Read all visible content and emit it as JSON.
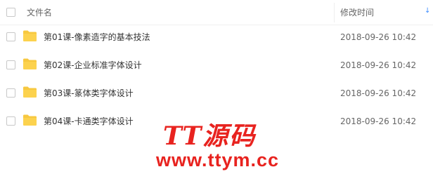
{
  "header": {
    "name_label": "文件名",
    "time_label": "修改时间",
    "sort_icon": "sort-arrow-down-icon"
  },
  "files": [
    {
      "name": "第01课-像素造字的基本技法",
      "modified": "2018-09-26 10:42",
      "icon": "folder-icon"
    },
    {
      "name": "第02课-企业标准字体设计",
      "modified": "2018-09-26 10:42",
      "icon": "folder-icon"
    },
    {
      "name": "第03课-篆体类字体设计",
      "modified": "2018-09-26 10:42",
      "icon": "folder-icon"
    },
    {
      "name": "第04课-卡通类字体设计",
      "modified": "2018-09-26 10:42",
      "icon": "folder-icon"
    }
  ],
  "watermark": {
    "title": "TT源码",
    "url": "www.ttym.cc"
  },
  "colors": {
    "folder": "#f7c840",
    "watermark": "#e8231f",
    "sort_accent": "#3b8cff"
  }
}
